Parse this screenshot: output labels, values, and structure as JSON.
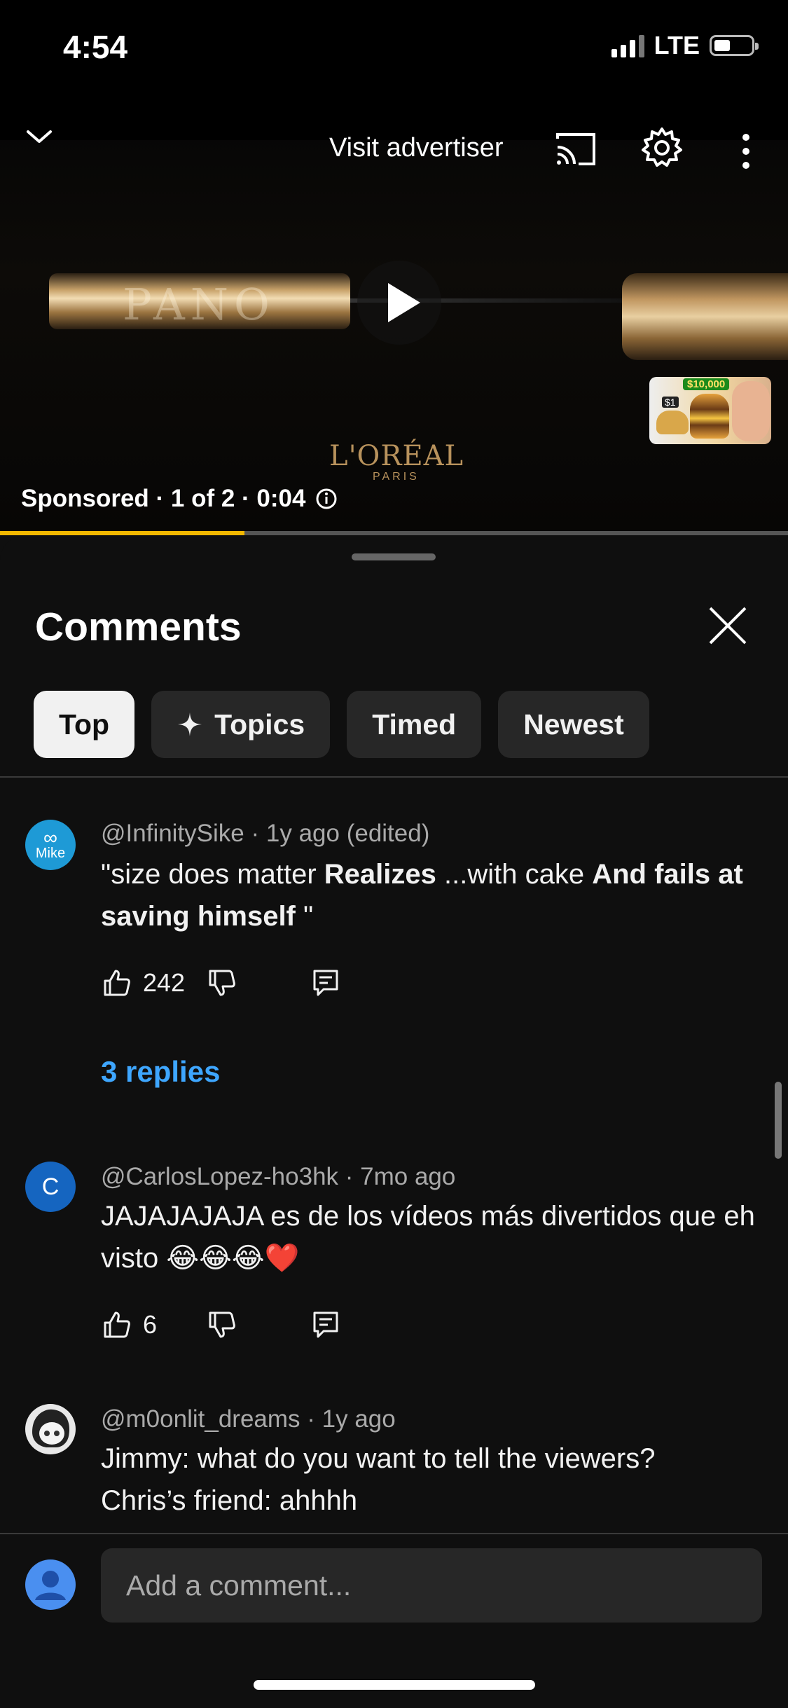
{
  "status": {
    "time": "4:54",
    "network": "LTE"
  },
  "player": {
    "visit_label": "Visit advertiser",
    "brand": "L'ORÉAL",
    "brand_sub": "PARIS",
    "product_text": "PANO",
    "thumb_badge": "$10,000",
    "thumb_price": "$1",
    "sponsored": "Sponsored · 1 of 2 · 0:04",
    "progress": 0.31,
    "progress_color": "#f2b800"
  },
  "comments": {
    "title": "Comments",
    "chips": [
      "Top",
      "Topics",
      "Timed",
      "Newest"
    ],
    "items": [
      {
        "author": "@InfinitySike",
        "meta": "1y ago (edited)",
        "avatar_text": "Mike",
        "avatar_color": "#1e9ad6",
        "text_parts": [
          "\"size does matter ",
          "Realizes",
          " ...with cake ",
          "And fails at saving himself",
          " \""
        ],
        "likes": "242",
        "replies": "3 replies"
      },
      {
        "author": "@CarlosLopez-ho3hk",
        "meta": "7mo ago",
        "avatar_text": "C",
        "avatar_color": "#1565c0",
        "text": "JAJAJAJAJA es de los vídeos más divertidos que eh visto 😂😂😂❤️",
        "likes": "6"
      },
      {
        "author": "@m0onlit_dreams",
        "meta": "1y ago",
        "line1": "Jimmy: what do you want to tell the viewers?",
        "line2": "Chris’s friend: ahhhh"
      }
    ]
  },
  "composer": {
    "placeholder": "Add a comment..."
  }
}
